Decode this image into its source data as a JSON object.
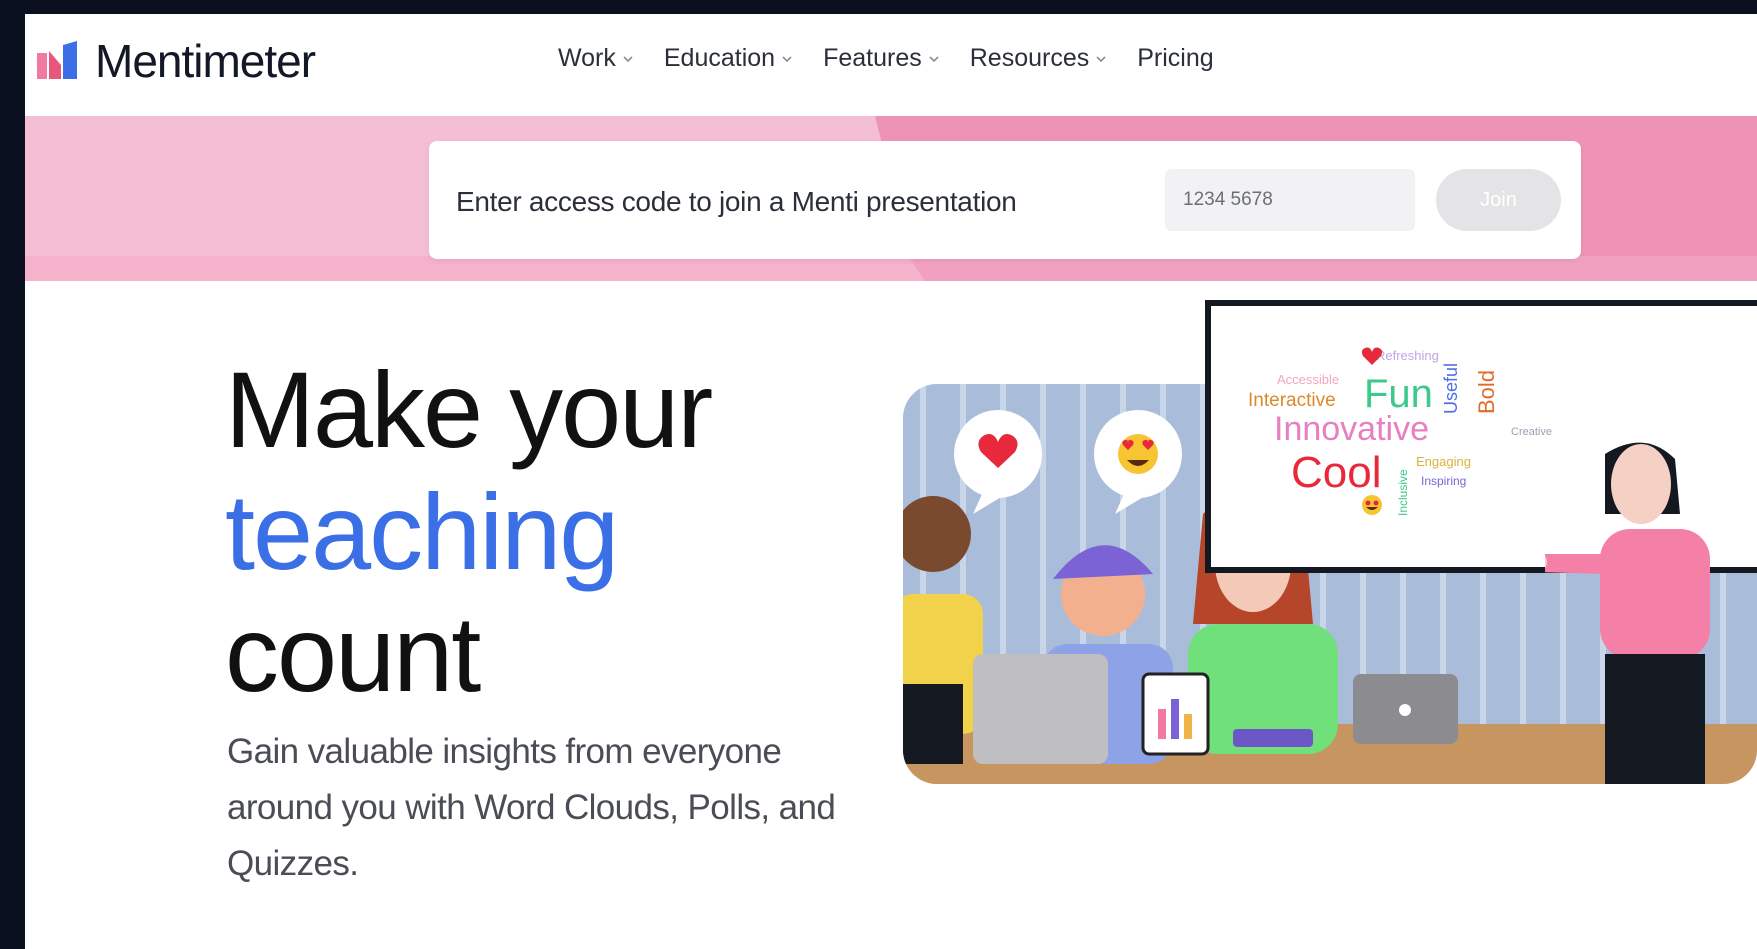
{
  "brand": {
    "name": "Mentimeter",
    "colors": {
      "accent_blue": "#3a6fe6",
      "banner_pink": "#f4b9cf",
      "banner_pink_dark": "#ee8fb3"
    }
  },
  "nav": {
    "items": [
      {
        "label": "Work",
        "has_dropdown": true
      },
      {
        "label": "Education",
        "has_dropdown": true
      },
      {
        "label": "Features",
        "has_dropdown": true
      },
      {
        "label": "Resources",
        "has_dropdown": true
      },
      {
        "label": "Pricing",
        "has_dropdown": false
      }
    ]
  },
  "join": {
    "prompt": "Enter access code to join a Menti presentation",
    "placeholder": "1234 5678",
    "button_label": "Join"
  },
  "hero": {
    "line1": "Make your",
    "line2": "teaching",
    "line3": "count",
    "subtitle": "Gain valuable insights from everyone around you with Word Clouds, Polls, and Quizzes."
  },
  "illustration": {
    "word_cloud": [
      "Refreshing",
      "Accessible",
      "Interactive",
      "Fun",
      "Useful",
      "Bold",
      "Innovative",
      "Cool",
      "Engaging",
      "Inspiring",
      "Inclusive",
      "Creative"
    ],
    "reactions": [
      "heart-icon",
      "heart-eyes-emoji-icon"
    ]
  }
}
